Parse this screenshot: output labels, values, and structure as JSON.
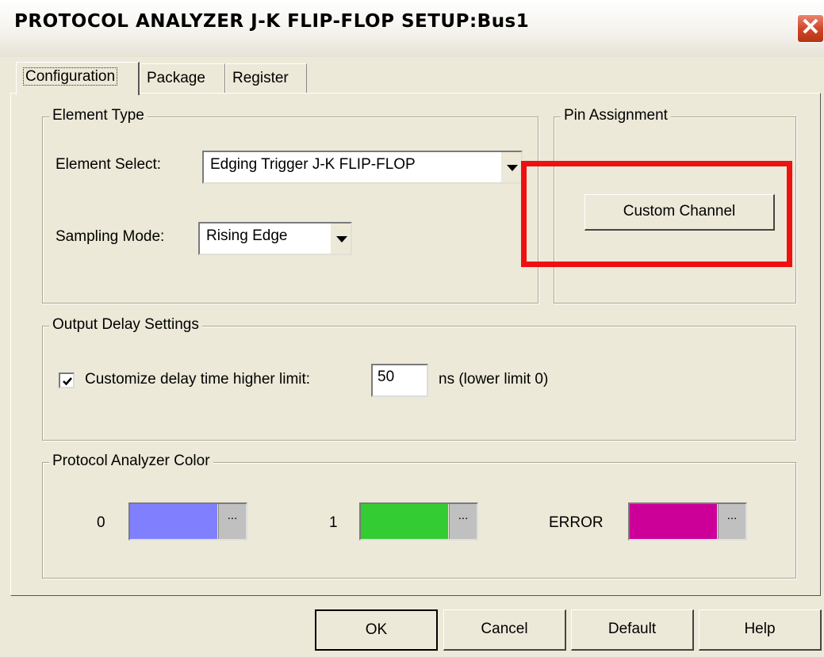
{
  "window": {
    "title": "PROTOCOL ANALYZER J-K FLIP-FLOP SETUP:Bus1",
    "close_glyph": "✕"
  },
  "tabs": [
    {
      "label": "Configuration",
      "active": true
    },
    {
      "label": "Package"
    },
    {
      "label": "Register"
    }
  ],
  "element_type": {
    "legend": "Element Type",
    "element_select_label": "Element Select:",
    "element_select_value": "Edging Trigger J-K FLIP-FLOP",
    "sampling_mode_label": "Sampling Mode:",
    "sampling_mode_value": "Rising Edge"
  },
  "pin_assignment": {
    "legend": "Pin Assignment",
    "custom_channel_label": "Custom Channel"
  },
  "output_delay": {
    "legend": "Output Delay Settings",
    "checkbox_checked": true,
    "checkbox_label": "Customize delay time higher limit:",
    "value": "50",
    "unit_note": "ns (lower limit 0)"
  },
  "colors": {
    "legend": "Protocol Analyzer Color",
    "items": [
      {
        "label": "0",
        "color": "#8080ff"
      },
      {
        "label": "1",
        "color": "#33cc33"
      },
      {
        "label": "ERROR",
        "color": "#cc0099"
      }
    ],
    "ellipsis": "..."
  },
  "footer": {
    "ok": "OK",
    "cancel": "Cancel",
    "default": "Default",
    "help": "Help"
  },
  "annotation": {
    "highlight_color": "#ee1111"
  }
}
